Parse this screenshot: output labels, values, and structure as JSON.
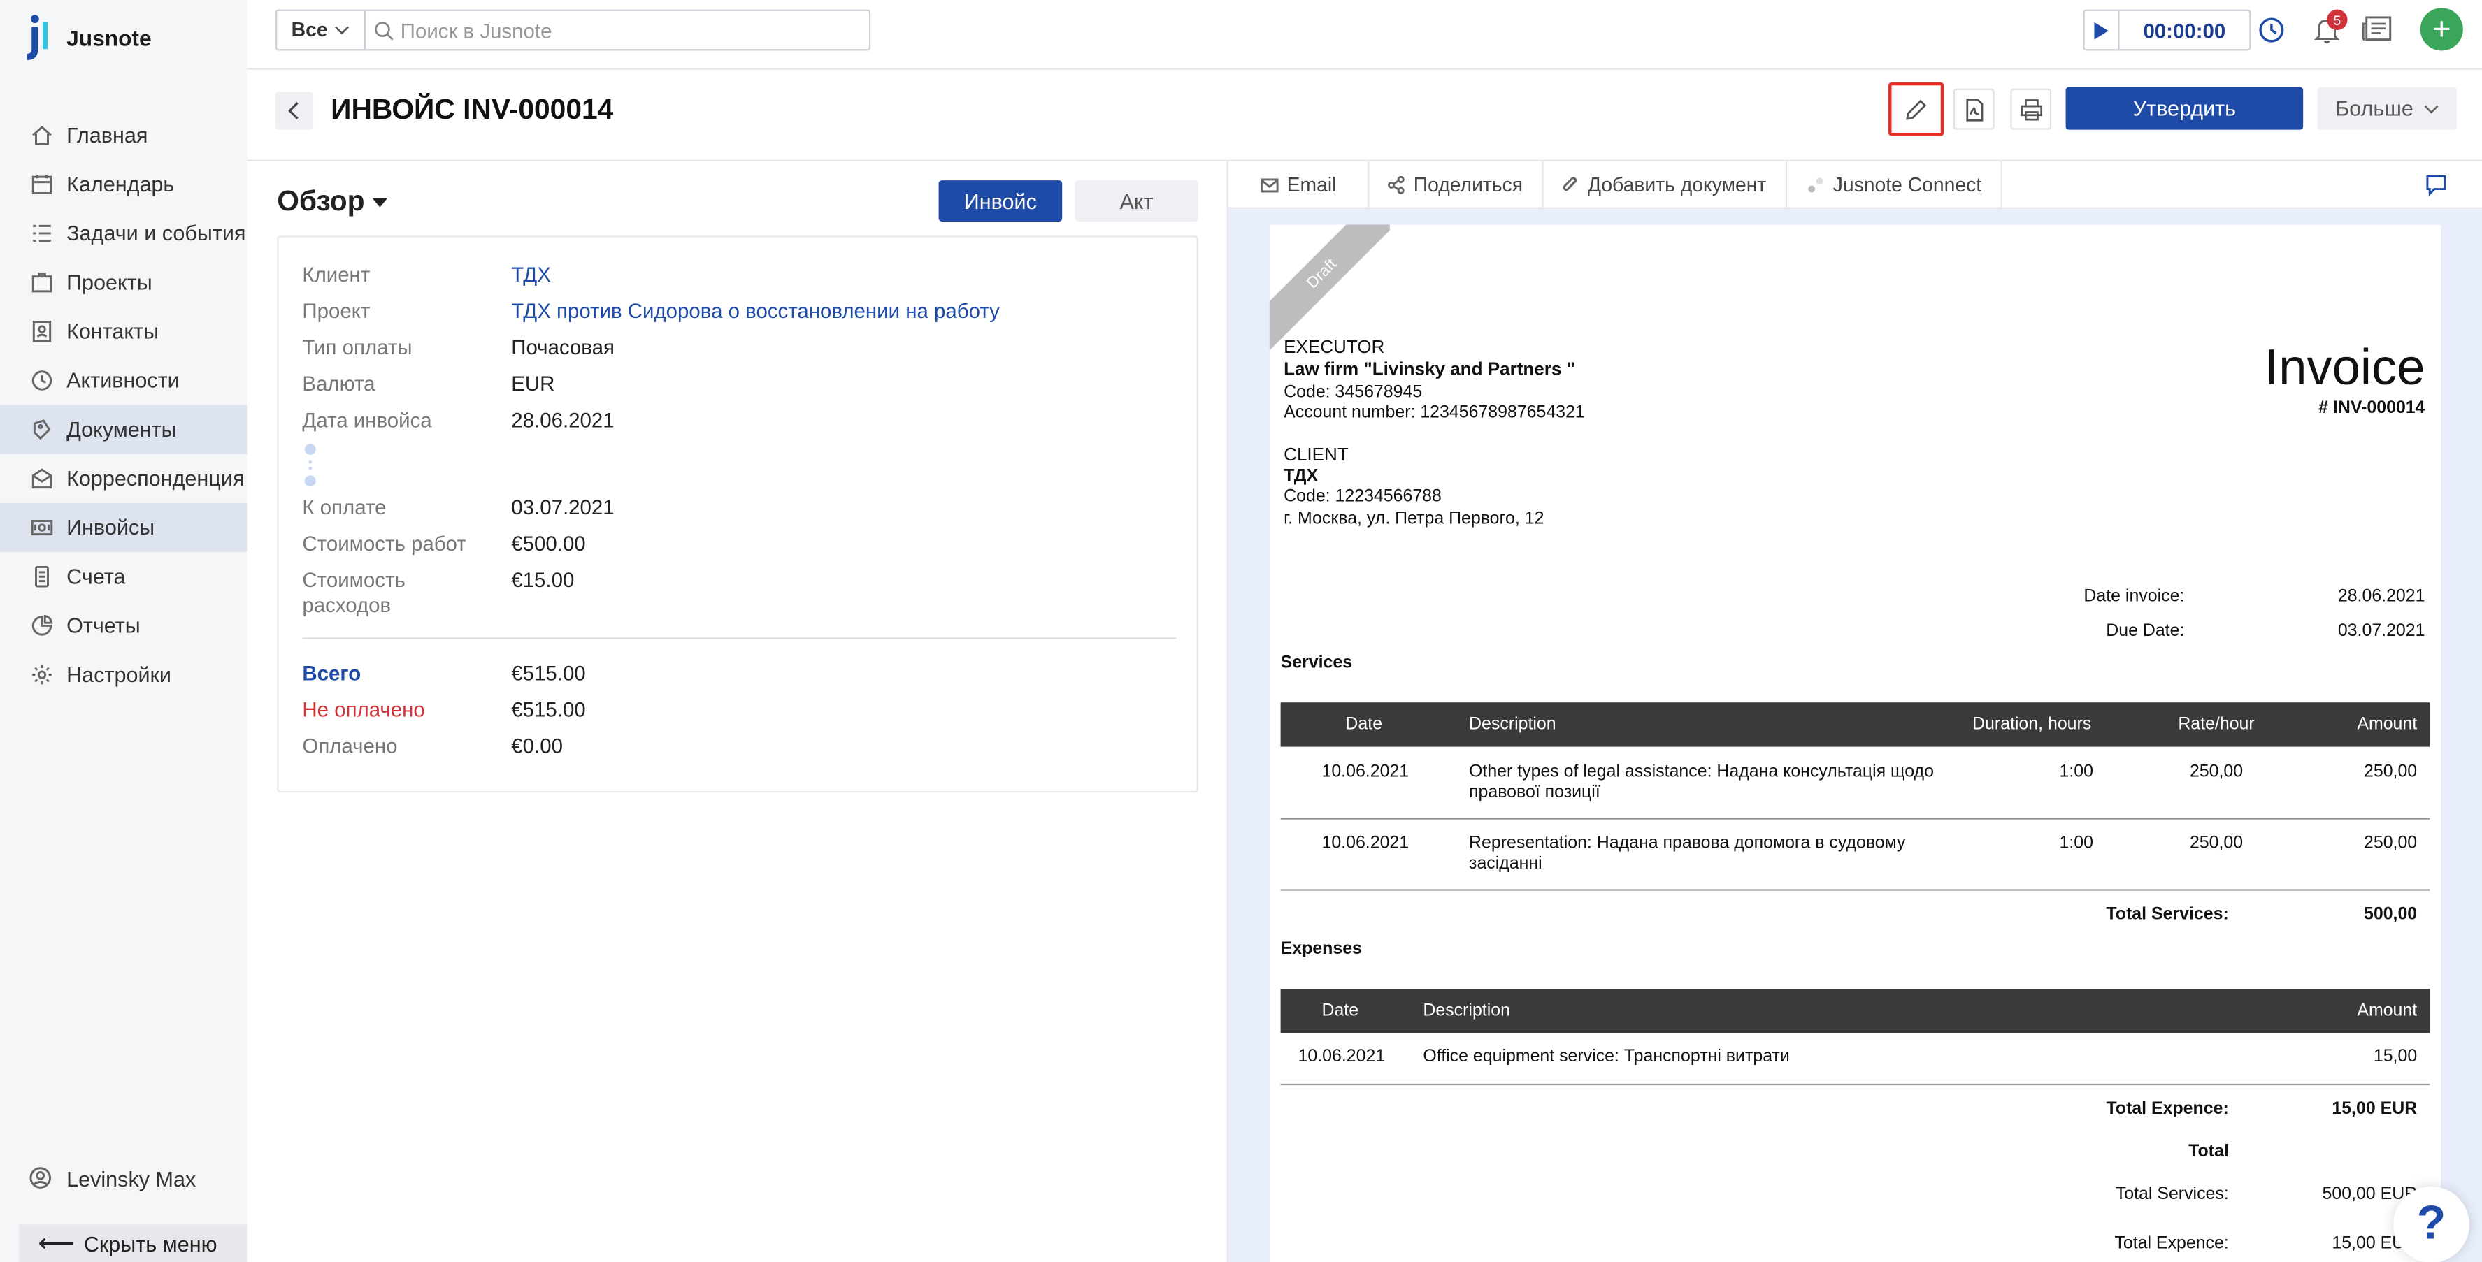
{
  "app": {
    "name": "Jusnote"
  },
  "sidebar": {
    "items": [
      {
        "label": "Главная",
        "icon": "home-icon"
      },
      {
        "label": "Календарь",
        "icon": "calendar-icon"
      },
      {
        "label": "Задачи и события",
        "icon": "tasks-icon"
      },
      {
        "label": "Проекты",
        "icon": "projects-icon"
      },
      {
        "label": "Контакты",
        "icon": "contacts-icon"
      },
      {
        "label": "Активности",
        "icon": "activity-icon"
      },
      {
        "label": "Документы",
        "icon": "documents-icon"
      },
      {
        "label": "Корреспонденция",
        "icon": "mail-icon"
      },
      {
        "label": "Инвойсы",
        "icon": "invoice-icon"
      },
      {
        "label": "Счета",
        "icon": "accounts-icon"
      },
      {
        "label": "Отчеты",
        "icon": "reports-icon"
      },
      {
        "label": "Настройки",
        "icon": "settings-icon"
      }
    ],
    "active": [
      "Документы",
      "Инвойсы"
    ],
    "user": "Levinsky Max",
    "hide_menu": "Скрыть меню"
  },
  "topbar": {
    "search_scope": "Все",
    "search_placeholder": "Поиск в Jusnote",
    "timer": "00:00:00",
    "notifications_count": "5"
  },
  "header": {
    "title": "ИНВОЙС INV-000014",
    "approve": "Утвердить",
    "more": "Больше"
  },
  "overview": {
    "title": "Обзор",
    "tab_invoice": "Инвойс",
    "tab_act": "Акт",
    "fields": [
      {
        "label": "Клиент",
        "value": "ТДХ"
      },
      {
        "label": "Проект",
        "value": "ТДХ против Сидорова о восстановлении на работу"
      },
      {
        "label": "Тип оплаты",
        "value": "Почасовая"
      },
      {
        "label": "Валюта",
        "value": "EUR"
      },
      {
        "label": "Дата инвойса",
        "value": "28.06.2021"
      },
      {
        "label": "К оплате",
        "value": "03.07.2021"
      },
      {
        "label": "Стоимость работ",
        "value": "€500.00"
      },
      {
        "label": "Стоимость расходов",
        "value": "€15.00"
      }
    ],
    "totals": [
      {
        "label": "Всего",
        "value": "€515.00"
      },
      {
        "label": "Не оплачено",
        "value": "€515.00"
      },
      {
        "label": "Оплачено",
        "value": "€0.00"
      }
    ]
  },
  "doc_tabs": {
    "email": "Email",
    "share": "Поделиться",
    "add_doc": "Добавить документ",
    "connect": "Jusnote Connect"
  },
  "invoice_doc": {
    "ribbon": "Draft",
    "executor_label": "EXECUTOR",
    "executor_name": "Law firm \"Livinsky and Partners \"",
    "executor_code": "Code: 345678945",
    "executor_account": "Account number: 12345678987654321",
    "client_label": "CLIENT",
    "client_name": "ТДХ",
    "client_code": "Code: 12234566788",
    "client_address": "г. Москва, ул. Петра Первого, 12",
    "title": "Invoice",
    "number": "# INV-000014",
    "date_invoice_label": "Date invoice:",
    "date_invoice": "28.06.2021",
    "due_date_label": "Due Date:",
    "due_date": "03.07.2021",
    "services_title": "Services",
    "services_headers": [
      "Date",
      "Description",
      "Duration, hours",
      "Rate/hour",
      "Amount"
    ],
    "services_rows": [
      {
        "date": "10.06.2021",
        "desc1": "Other types of legal assistance: Надана консультація щодо",
        "desc2": "правової позиції",
        "duration": "1:00",
        "rate": "250,00",
        "amount": "250,00"
      },
      {
        "date": "10.06.2021",
        "desc1": "Representation: Надана правова допомога в судовому",
        "desc2": "засіданні",
        "duration": "1:00",
        "rate": "250,00",
        "amount": "250,00"
      }
    ],
    "total_services_label": "Total Services:",
    "total_services": "500,00",
    "expenses_title": "Expenses",
    "expenses_headers": [
      "Date",
      "Description",
      "Amount"
    ],
    "expenses_rows": [
      {
        "date": "10.06.2021",
        "desc": "Office equipment service: Транспортні витрати",
        "amount": "15,00"
      }
    ],
    "total_expence_label": "Total Expence:",
    "total_expence": "15,00 EUR",
    "total_label": "Total",
    "sum_services_label": "Total Services:",
    "sum_services": "500,00 EUR",
    "sum_expence_label": "Total Expence:",
    "sum_expence": "15,00 EUR"
  },
  "help": "?",
  "colors": {
    "accent": "#1e4aa8",
    "danger": "#d0343a",
    "highlight_box": "#e0322a"
  }
}
